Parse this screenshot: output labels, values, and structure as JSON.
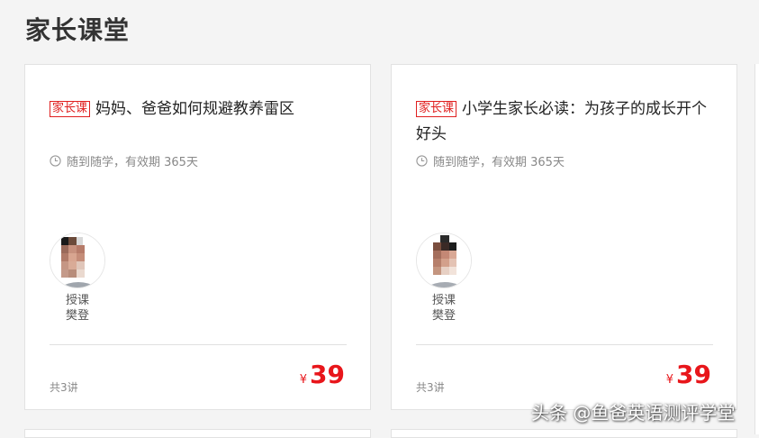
{
  "page": {
    "title": "家长课堂"
  },
  "courses": [
    {
      "tag": "家长课",
      "title": "妈妈、爸爸如何规避教养雷区",
      "validity": "随到随学，有效期 365天",
      "teacher_label": "授课",
      "teacher_name": "樊登",
      "lessons": "共3讲",
      "currency": "¥",
      "price": "39"
    },
    {
      "tag": "家长课",
      "title": "小学生家长必读：为孩子的成长开个好头",
      "validity": "随到随学，有效期 365天",
      "teacher_label": "授课",
      "teacher_name": "樊登",
      "lessons": "共3讲",
      "currency": "¥",
      "price": "39"
    }
  ],
  "watermark": "头条 @鱼爸英语测评学堂",
  "colors": {
    "accent": "#e8161b",
    "tag": "#e02020",
    "background": "#f4f4f4",
    "card": "#ffffff"
  },
  "icons": {
    "validity": "clock-icon",
    "teacher": "avatar"
  }
}
